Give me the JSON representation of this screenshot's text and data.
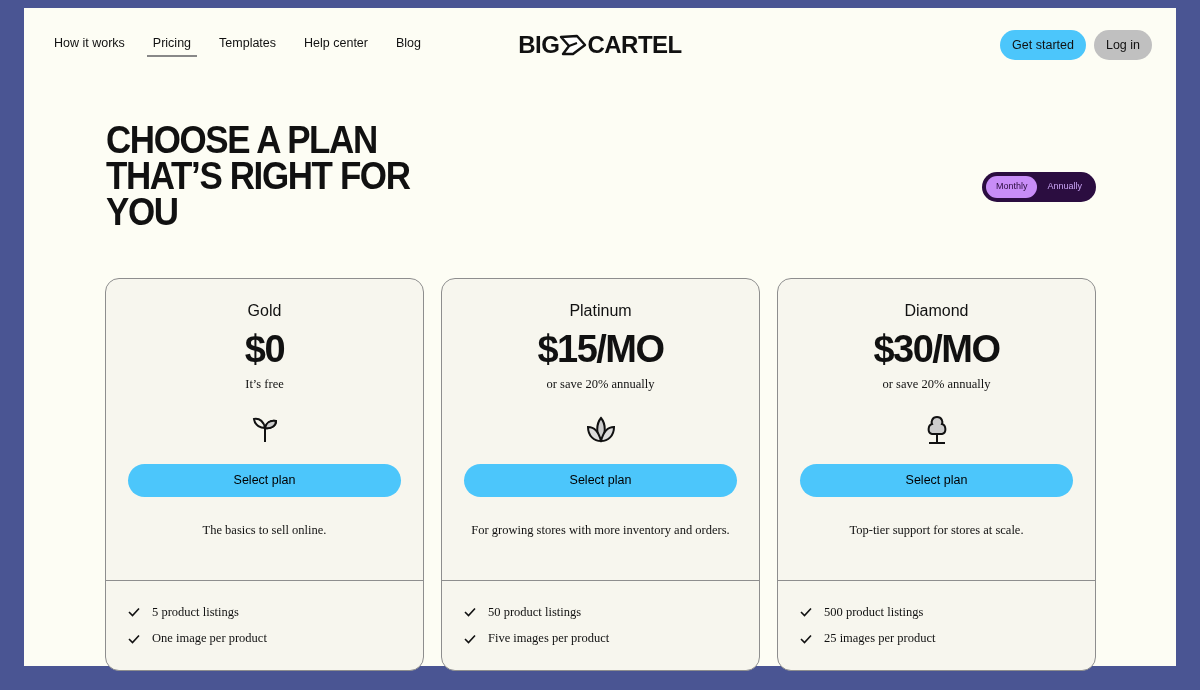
{
  "nav": {
    "links": [
      {
        "label": "How it works",
        "selected": false
      },
      {
        "label": "Pricing",
        "selected": true
      },
      {
        "label": "Templates",
        "selected": false
      },
      {
        "label": "Help center",
        "selected": false
      },
      {
        "label": "Blog",
        "selected": false
      }
    ],
    "logo": {
      "left": "BIG",
      "right": "CARTEL"
    },
    "buttons": [
      {
        "label": "Get started",
        "kind": "primary"
      },
      {
        "label": "Log in",
        "kind": "secondary"
      }
    ]
  },
  "heading": "CHOOSE A PLAN THAT’S RIGHT FOR YOU",
  "billing_toggle": [
    {
      "label": "Monthly",
      "selected": true
    },
    {
      "label": "Annually",
      "selected": false
    }
  ],
  "plans": [
    {
      "name": "Gold",
      "price": "$0",
      "note": "It’s free",
      "kind": "sprout",
      "button": "Select plan",
      "description": "The basics to sell online.",
      "features": [
        "5 product listings",
        "One image per product"
      ]
    },
    {
      "name": "Platinum",
      "price": "$15/MO",
      "note": "or save 20% annually",
      "kind": "lotus",
      "button": "Select plan",
      "description": "For growing stores with more inventory and orders.",
      "features": [
        "50 product listings",
        "Five images per product"
      ]
    },
    {
      "name": "Diamond",
      "price": "$30/MO",
      "note": "or save 20% annually",
      "kind": "tree",
      "button": "Select plan",
      "description": "Top-tier support for stores at scale.",
      "features": [
        "500 product listings",
        "25 images per product"
      ]
    }
  ]
}
